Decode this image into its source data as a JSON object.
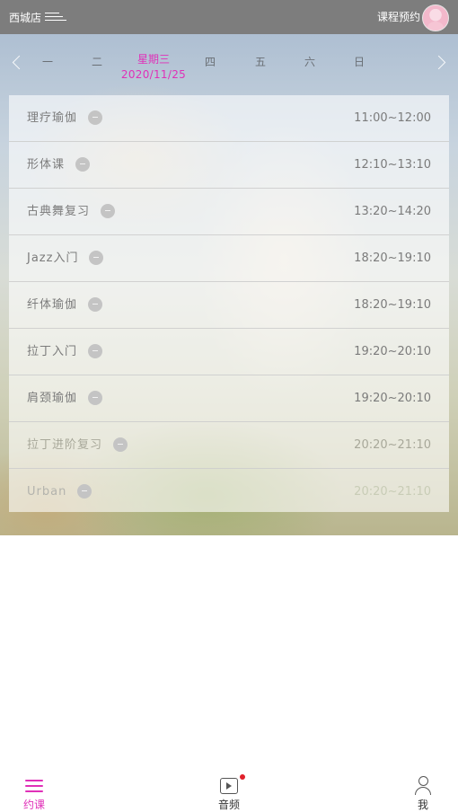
{
  "header": {
    "store_name": "西城店",
    "title": "课程预约"
  },
  "week": {
    "days": [
      {
        "label": "一"
      },
      {
        "label": "二"
      },
      {
        "label": "星期三",
        "date": "2020/11/25",
        "selected": true
      },
      {
        "label": "四"
      },
      {
        "label": "五"
      },
      {
        "label": "六"
      },
      {
        "label": "日"
      }
    ]
  },
  "courses": [
    {
      "name": "理疗瑜伽",
      "time": "11:00~12:00"
    },
    {
      "name": "形体课",
      "time": "12:10~13:10"
    },
    {
      "name": "古典舞复习",
      "time": "13:20~14:20"
    },
    {
      "name": "Jazz入门",
      "time": "18:20~19:10"
    },
    {
      "name": "纤体瑜伽",
      "time": "18:20~19:10"
    },
    {
      "name": "拉丁入门",
      "time": "19:20~20:10"
    },
    {
      "name": "肩颈瑜伽",
      "time": "19:20~20:10"
    },
    {
      "name": "拉丁进阶复习",
      "time": "20:20~21:10"
    },
    {
      "name": "Urban",
      "time": "20:20~21:10"
    }
  ],
  "bottom_nav": {
    "items": [
      {
        "label": "约课",
        "icon": "hamburger-icon",
        "active": true
      },
      {
        "label": "音频",
        "icon": "play-icon",
        "has_notification": true
      },
      {
        "label": "我",
        "icon": "person-icon"
      }
    ]
  },
  "colors": {
    "accent": "#e030b8",
    "topbar": "#7d7d7d",
    "notification": "#e0202a"
  }
}
